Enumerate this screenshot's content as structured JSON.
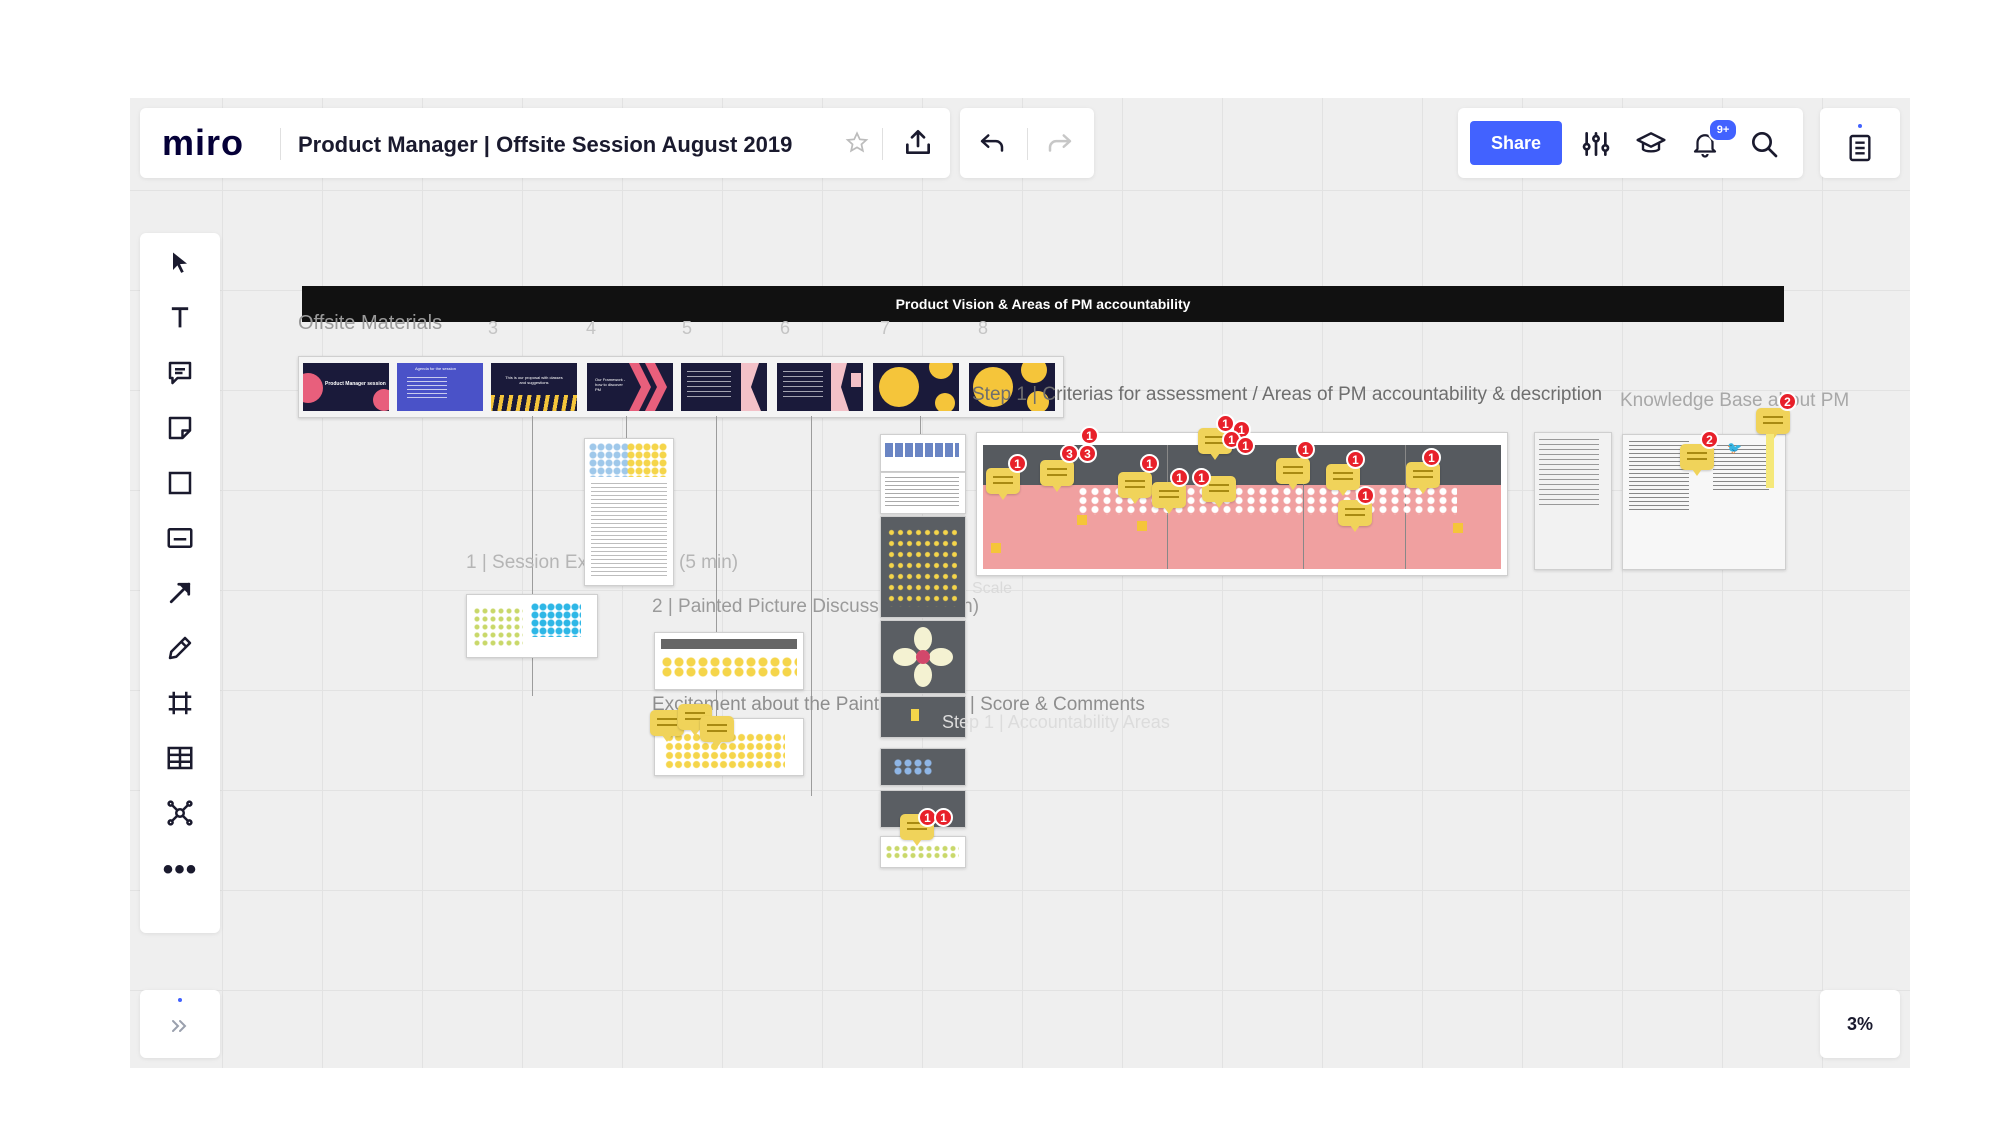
{
  "app": {
    "logo": "miro",
    "board_title": "Product Manager | Offsite Session August 2019"
  },
  "header": {
    "share_label": "Share",
    "notification_count": "9+"
  },
  "toolbar": {
    "tools": [
      "select-tool",
      "text-tool",
      "comment-tool",
      "sticky-note-tool",
      "shape-tool",
      "card-tool",
      "arrow-tool",
      "pen-tool",
      "frame-tool",
      "table-tool",
      "mind-map-tool",
      "more-tools"
    ]
  },
  "zoom": {
    "level": "3%"
  },
  "canvas": {
    "banner_title": "Product Vision & Areas of PM accountability",
    "offsite_materials": "Offsite Materials",
    "slide_numbers": [
      "3",
      "4",
      "5",
      "6",
      "7",
      "8"
    ],
    "step_criteria": "Step 1 | Criterias for assessment / Areas of PM accountability & description",
    "knowledge_base": "Knowledge Base about PM",
    "session_expectations": "1 | Session Expectations (5 min)",
    "painted_picture": "2 | Painted Picture Discussion (30 min)",
    "excitement": "Excitement about the Painted Picture | Score & Comments",
    "step_accountability": "Step 1 | Accountability Areas",
    "scale_label": "Scale",
    "slide_titles": [
      "Product Manager session",
      "Agenda for the session",
      "This is our proposal with classes and suggestions",
      "Our Framework - how to discover PM"
    ],
    "comment_counts": [
      "1",
      "3",
      "3",
      "1",
      "1",
      "1",
      "1",
      "1",
      "1",
      "1",
      "1",
      "1",
      "1",
      "1",
      "1",
      "1",
      "2",
      "2",
      "1",
      "1"
    ]
  },
  "colors": {
    "share_blue": "#4262ff",
    "banner_black": "#111111",
    "pink_area": "#f0a0a0",
    "dark_area": "#565a5f",
    "sticky_yellow": "#f5d54a",
    "badge_red": "#e8202a"
  }
}
